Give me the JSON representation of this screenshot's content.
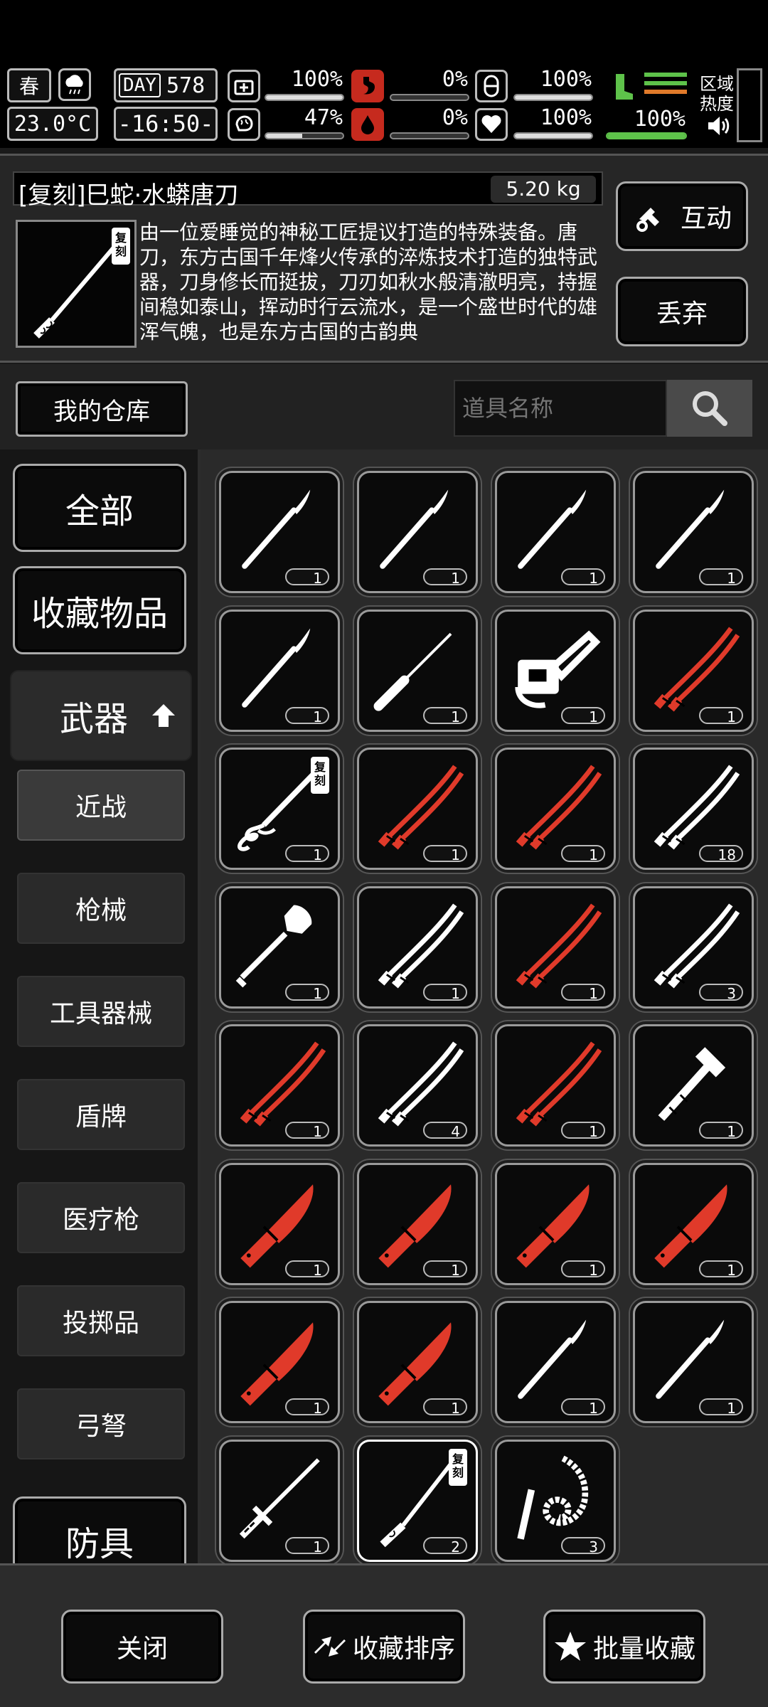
{
  "hud": {
    "season": "春",
    "temperature": "23.0°C",
    "day_label": "DAY",
    "day_number": "578",
    "clock": "-16:50-",
    "stats": [
      {
        "name": "health",
        "value": "100%",
        "level": 1.0
      },
      {
        "name": "hunger",
        "value": "0%",
        "level": 0.0
      },
      {
        "name": "stamina",
        "value": "100%",
        "level": 1.0
      },
      {
        "name": "sanity",
        "value": "47%",
        "level": 0.47
      },
      {
        "name": "thirst",
        "value": "0%",
        "level": 0.0
      },
      {
        "name": "heart",
        "value": "100%",
        "level": 1.0
      },
      {
        "name": "leg",
        "value": "100%",
        "level": 1.0
      }
    ],
    "region_label_1": "区域",
    "region_label_2": "热度",
    "colors": {
      "bar": "#dddddd",
      "leg_bar": "#5ec24a",
      "accent_red": "#e03a2a"
    }
  },
  "item": {
    "name": "[复刻]巳蛇·水蟒唐刀",
    "weight": "5.20 kg",
    "tag": "复刻",
    "description": "由一位爱睡觉的神秘工匠提议打造的特殊装备。唐刀，东方古国千年烽火传承的淬炼技术打造的独特武器，刀身修长而挺拔，刀刃如秋水般清澈明亮，持握间稳如泰山，挥动时行云流水，是一个盛世时代的雄浑气魄，也是东方古国的古韵典",
    "interact_label": "互动",
    "discard_label": "丢弃"
  },
  "warehouse": {
    "label": "我的仓库",
    "search_placeholder": "道具名称"
  },
  "categories": {
    "all": "全部",
    "favorites": "收藏物品",
    "weapons": "武器",
    "armor": "防具",
    "subs": [
      "近战",
      "枪械",
      "工具器械",
      "盾牌",
      "医疗枪",
      "投掷品",
      "弓弩"
    ]
  },
  "grid": [
    {
      "icon": "scalpel-icon",
      "color": "white",
      "count": "1"
    },
    {
      "icon": "scalpel-icon",
      "color": "white",
      "count": "1"
    },
    {
      "icon": "scalpel-icon",
      "color": "white",
      "count": "1"
    },
    {
      "icon": "scalpel-icon",
      "color": "white",
      "count": "1"
    },
    {
      "icon": "scalpel-icon",
      "color": "white",
      "count": "1"
    },
    {
      "icon": "screwdriver-icon",
      "color": "white",
      "count": "1"
    },
    {
      "icon": "chainsaw-icon",
      "color": "white",
      "count": "1"
    },
    {
      "icon": "katana-icon",
      "color": "red",
      "count": "1"
    },
    {
      "icon": "dragon-blade-icon",
      "color": "white",
      "count": "1",
      "tag": "复刻"
    },
    {
      "icon": "katana-icon",
      "color": "red",
      "count": "1"
    },
    {
      "icon": "katana-icon",
      "color": "red",
      "count": "1"
    },
    {
      "icon": "katana-icon",
      "color": "white",
      "count": "18"
    },
    {
      "icon": "shovel-icon",
      "color": "white",
      "count": "1"
    },
    {
      "icon": "katana-icon",
      "color": "white",
      "count": "1"
    },
    {
      "icon": "katana-icon",
      "color": "red",
      "count": "1"
    },
    {
      "icon": "katana-icon",
      "color": "white",
      "count": "3"
    },
    {
      "icon": "katana-icon",
      "color": "red",
      "count": "1"
    },
    {
      "icon": "katana-icon",
      "color": "white",
      "count": "4"
    },
    {
      "icon": "katana-icon",
      "color": "red",
      "count": "1"
    },
    {
      "icon": "hammer-icon",
      "color": "white",
      "count": "1"
    },
    {
      "icon": "combat-knife-icon",
      "color": "red",
      "count": "1"
    },
    {
      "icon": "combat-knife-icon",
      "color": "red",
      "count": "1"
    },
    {
      "icon": "combat-knife-icon",
      "color": "red",
      "count": "1"
    },
    {
      "icon": "combat-knife-icon",
      "color": "red",
      "count": "1"
    },
    {
      "icon": "combat-knife-icon",
      "color": "red",
      "count": "1"
    },
    {
      "icon": "combat-knife-icon",
      "color": "red",
      "count": "1"
    },
    {
      "icon": "scalpel-icon",
      "color": "white",
      "count": "1"
    },
    {
      "icon": "scalpel-icon",
      "color": "white",
      "count": "1"
    },
    {
      "icon": "ornate-sword-icon",
      "color": "white",
      "count": "1"
    },
    {
      "icon": "tang-dao-icon",
      "color": "white",
      "count": "2",
      "tag": "复刻",
      "selected": true
    },
    {
      "icon": "whip-icon",
      "color": "white",
      "count": "3"
    }
  ],
  "bottom": {
    "close_label": "关闭",
    "sort_label": "收藏排序",
    "batch_label": "批量收藏"
  }
}
